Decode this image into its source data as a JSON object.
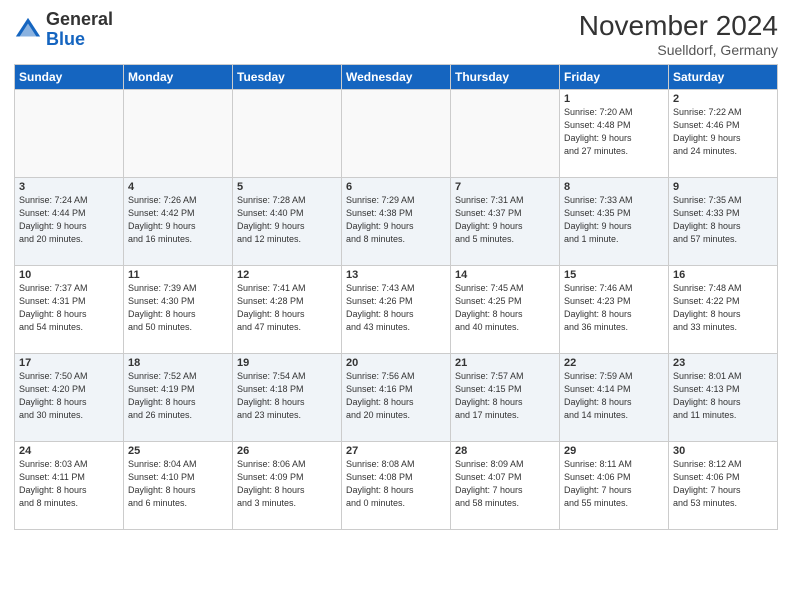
{
  "header": {
    "logo_general": "General",
    "logo_blue": "Blue",
    "month_title": "November 2024",
    "location": "Suelldorf, Germany"
  },
  "weekdays": [
    "Sunday",
    "Monday",
    "Tuesday",
    "Wednesday",
    "Thursday",
    "Friday",
    "Saturday"
  ],
  "weeks": [
    [
      {
        "day": "",
        "info": ""
      },
      {
        "day": "",
        "info": ""
      },
      {
        "day": "",
        "info": ""
      },
      {
        "day": "",
        "info": ""
      },
      {
        "day": "",
        "info": ""
      },
      {
        "day": "1",
        "info": "Sunrise: 7:20 AM\nSunset: 4:48 PM\nDaylight: 9 hours\nand 27 minutes."
      },
      {
        "day": "2",
        "info": "Sunrise: 7:22 AM\nSunset: 4:46 PM\nDaylight: 9 hours\nand 24 minutes."
      }
    ],
    [
      {
        "day": "3",
        "info": "Sunrise: 7:24 AM\nSunset: 4:44 PM\nDaylight: 9 hours\nand 20 minutes."
      },
      {
        "day": "4",
        "info": "Sunrise: 7:26 AM\nSunset: 4:42 PM\nDaylight: 9 hours\nand 16 minutes."
      },
      {
        "day": "5",
        "info": "Sunrise: 7:28 AM\nSunset: 4:40 PM\nDaylight: 9 hours\nand 12 minutes."
      },
      {
        "day": "6",
        "info": "Sunrise: 7:29 AM\nSunset: 4:38 PM\nDaylight: 9 hours\nand 8 minutes."
      },
      {
        "day": "7",
        "info": "Sunrise: 7:31 AM\nSunset: 4:37 PM\nDaylight: 9 hours\nand 5 minutes."
      },
      {
        "day": "8",
        "info": "Sunrise: 7:33 AM\nSunset: 4:35 PM\nDaylight: 9 hours\nand 1 minute."
      },
      {
        "day": "9",
        "info": "Sunrise: 7:35 AM\nSunset: 4:33 PM\nDaylight: 8 hours\nand 57 minutes."
      }
    ],
    [
      {
        "day": "10",
        "info": "Sunrise: 7:37 AM\nSunset: 4:31 PM\nDaylight: 8 hours\nand 54 minutes."
      },
      {
        "day": "11",
        "info": "Sunrise: 7:39 AM\nSunset: 4:30 PM\nDaylight: 8 hours\nand 50 minutes."
      },
      {
        "day": "12",
        "info": "Sunrise: 7:41 AM\nSunset: 4:28 PM\nDaylight: 8 hours\nand 47 minutes."
      },
      {
        "day": "13",
        "info": "Sunrise: 7:43 AM\nSunset: 4:26 PM\nDaylight: 8 hours\nand 43 minutes."
      },
      {
        "day": "14",
        "info": "Sunrise: 7:45 AM\nSunset: 4:25 PM\nDaylight: 8 hours\nand 40 minutes."
      },
      {
        "day": "15",
        "info": "Sunrise: 7:46 AM\nSunset: 4:23 PM\nDaylight: 8 hours\nand 36 minutes."
      },
      {
        "day": "16",
        "info": "Sunrise: 7:48 AM\nSunset: 4:22 PM\nDaylight: 8 hours\nand 33 minutes."
      }
    ],
    [
      {
        "day": "17",
        "info": "Sunrise: 7:50 AM\nSunset: 4:20 PM\nDaylight: 8 hours\nand 30 minutes."
      },
      {
        "day": "18",
        "info": "Sunrise: 7:52 AM\nSunset: 4:19 PM\nDaylight: 8 hours\nand 26 minutes."
      },
      {
        "day": "19",
        "info": "Sunrise: 7:54 AM\nSunset: 4:18 PM\nDaylight: 8 hours\nand 23 minutes."
      },
      {
        "day": "20",
        "info": "Sunrise: 7:56 AM\nSunset: 4:16 PM\nDaylight: 8 hours\nand 20 minutes."
      },
      {
        "day": "21",
        "info": "Sunrise: 7:57 AM\nSunset: 4:15 PM\nDaylight: 8 hours\nand 17 minutes."
      },
      {
        "day": "22",
        "info": "Sunrise: 7:59 AM\nSunset: 4:14 PM\nDaylight: 8 hours\nand 14 minutes."
      },
      {
        "day": "23",
        "info": "Sunrise: 8:01 AM\nSunset: 4:13 PM\nDaylight: 8 hours\nand 11 minutes."
      }
    ],
    [
      {
        "day": "24",
        "info": "Sunrise: 8:03 AM\nSunset: 4:11 PM\nDaylight: 8 hours\nand 8 minutes."
      },
      {
        "day": "25",
        "info": "Sunrise: 8:04 AM\nSunset: 4:10 PM\nDaylight: 8 hours\nand 6 minutes."
      },
      {
        "day": "26",
        "info": "Sunrise: 8:06 AM\nSunset: 4:09 PM\nDaylight: 8 hours\nand 3 minutes."
      },
      {
        "day": "27",
        "info": "Sunrise: 8:08 AM\nSunset: 4:08 PM\nDaylight: 8 hours\nand 0 minutes."
      },
      {
        "day": "28",
        "info": "Sunrise: 8:09 AM\nSunset: 4:07 PM\nDaylight: 7 hours\nand 58 minutes."
      },
      {
        "day": "29",
        "info": "Sunrise: 8:11 AM\nSunset: 4:06 PM\nDaylight: 7 hours\nand 55 minutes."
      },
      {
        "day": "30",
        "info": "Sunrise: 8:12 AM\nSunset: 4:06 PM\nDaylight: 7 hours\nand 53 minutes."
      }
    ]
  ]
}
